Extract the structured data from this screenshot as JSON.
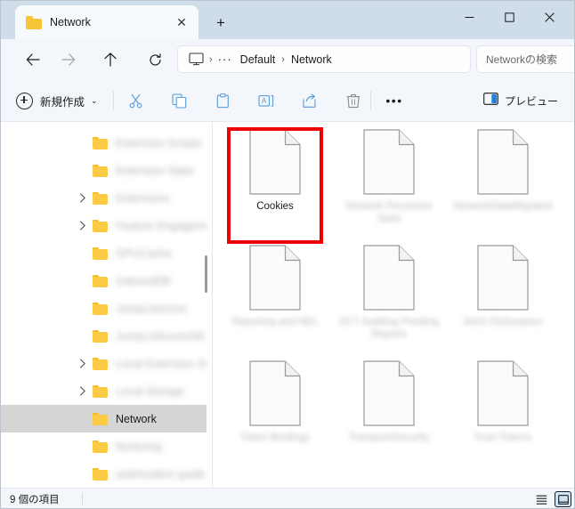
{
  "window": {
    "title": "Network",
    "tab_icon": "folder-icon",
    "controls": {
      "minimize": "—",
      "maximize": "□",
      "close": "✕"
    },
    "new_tab": "+",
    "tab_close": "✕"
  },
  "nav": {
    "back": "back-arrow-icon",
    "forward": "forward-arrow-icon",
    "up": "up-arrow-icon",
    "refresh": "refresh-icon",
    "breadcrumb": {
      "root_icon": "monitor-icon",
      "sep": "›",
      "overflow": "···",
      "items": [
        "Default",
        "Network"
      ]
    }
  },
  "search": {
    "placeholder": "Networkの検索"
  },
  "toolbar": {
    "new_label": "新規作成",
    "new_chevron": "⌄",
    "cut": "cut-icon",
    "copy": "copy-icon",
    "paste": "paste-icon",
    "rename": "rename-icon",
    "share": "share-icon",
    "delete": "delete-icon",
    "more": "•••",
    "preview_label": "プレビュー"
  },
  "sidebar": {
    "items": [
      {
        "label": "Extension Scripts",
        "blurred": true,
        "expandable": false,
        "selected": false
      },
      {
        "label": "Extension State",
        "blurred": true,
        "expandable": false,
        "selected": false
      },
      {
        "label": "Extensions",
        "blurred": true,
        "expandable": true,
        "selected": false
      },
      {
        "label": "Feature Engagement Tracker",
        "blurred": true,
        "expandable": true,
        "selected": false
      },
      {
        "label": "GPUCache",
        "blurred": true,
        "expandable": false,
        "selected": false
      },
      {
        "label": "IndexedDB",
        "blurred": true,
        "expandable": false,
        "selected": false
      },
      {
        "label": "JumpListIcons",
        "blurred": true,
        "expandable": false,
        "selected": false
      },
      {
        "label": "JumpListIconsOld",
        "blurred": true,
        "expandable": false,
        "selected": false
      },
      {
        "label": "Local Extension Settings",
        "blurred": true,
        "expandable": true,
        "selected": false
      },
      {
        "label": "Local Storage",
        "blurred": true,
        "expandable": true,
        "selected": false
      },
      {
        "label": "Network",
        "blurred": false,
        "expandable": false,
        "selected": true
      },
      {
        "label": "Nurturing",
        "blurred": true,
        "expandable": false,
        "selected": false
      },
      {
        "label": "optimization guide",
        "blurred": true,
        "expandable": false,
        "selected": false
      }
    ]
  },
  "files": [
    {
      "name": "Cookies",
      "blurred": false,
      "highlighted": true
    },
    {
      "name": "Network Persistent State",
      "blurred": true,
      "highlighted": false
    },
    {
      "name": "NetworkDataMigrated",
      "blurred": true,
      "highlighted": false
    },
    {
      "name": "Reporting and NEL",
      "blurred": true,
      "highlighted": false
    },
    {
      "name": "SCT Auditing Pending Reports",
      "blurred": true,
      "highlighted": false
    },
    {
      "name": "Sdch Dictionaries",
      "blurred": true,
      "highlighted": false
    },
    {
      "name": "Token Bindings",
      "blurred": true,
      "highlighted": false
    },
    {
      "name": "TransportSecurity",
      "blurred": true,
      "highlighted": false
    },
    {
      "name": "Trust Tokens",
      "blurred": true,
      "highlighted": false
    }
  ],
  "status": {
    "item_count": "9 個の項目",
    "view_list": "list-view-icon",
    "view_details": "details-view-icon"
  },
  "colors": {
    "titlebar": "#cfdcea",
    "chrome": "#f3f6fa",
    "folder": "#fbcb46",
    "annotation": "#ee0000",
    "selection": "#d5d5d5",
    "accent": "#0067c0"
  }
}
